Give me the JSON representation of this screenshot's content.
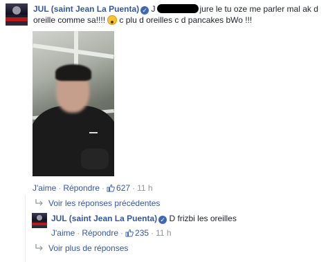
{
  "comment": {
    "author": "JUL (saint Jean La Puenta)",
    "text_start": "J",
    "text_mid": "jure le tu oze me parler mal ak d",
    "text_line2_a": "oreille comme sa!!!!",
    "text_line2_b": "c plu d oreilles c d pancakes bWo !!!",
    "like_label": "J'aime",
    "reply_label": "Répondre",
    "likes": "627",
    "time": "11 h"
  },
  "previous_replies": "Voir les réponses précédentes",
  "reply": {
    "author": "JUL (saint Jean La Puenta)",
    "text": "D frizbi les oreilles",
    "like_label": "J'aime",
    "reply_label": "Répondre",
    "likes": "235",
    "time": "11 h"
  },
  "more_replies": "Voir plus de réponses",
  "icons": {
    "verified": "verified-badge-icon",
    "emoji": "scream-emoji-icon",
    "like": "thumbs-up-icon",
    "reply_arrow": "reply-arrow-icon"
  },
  "colors": {
    "link": "#365899",
    "muted": "#90949c",
    "text": "#1d2129",
    "verified": "#4267b2"
  }
}
